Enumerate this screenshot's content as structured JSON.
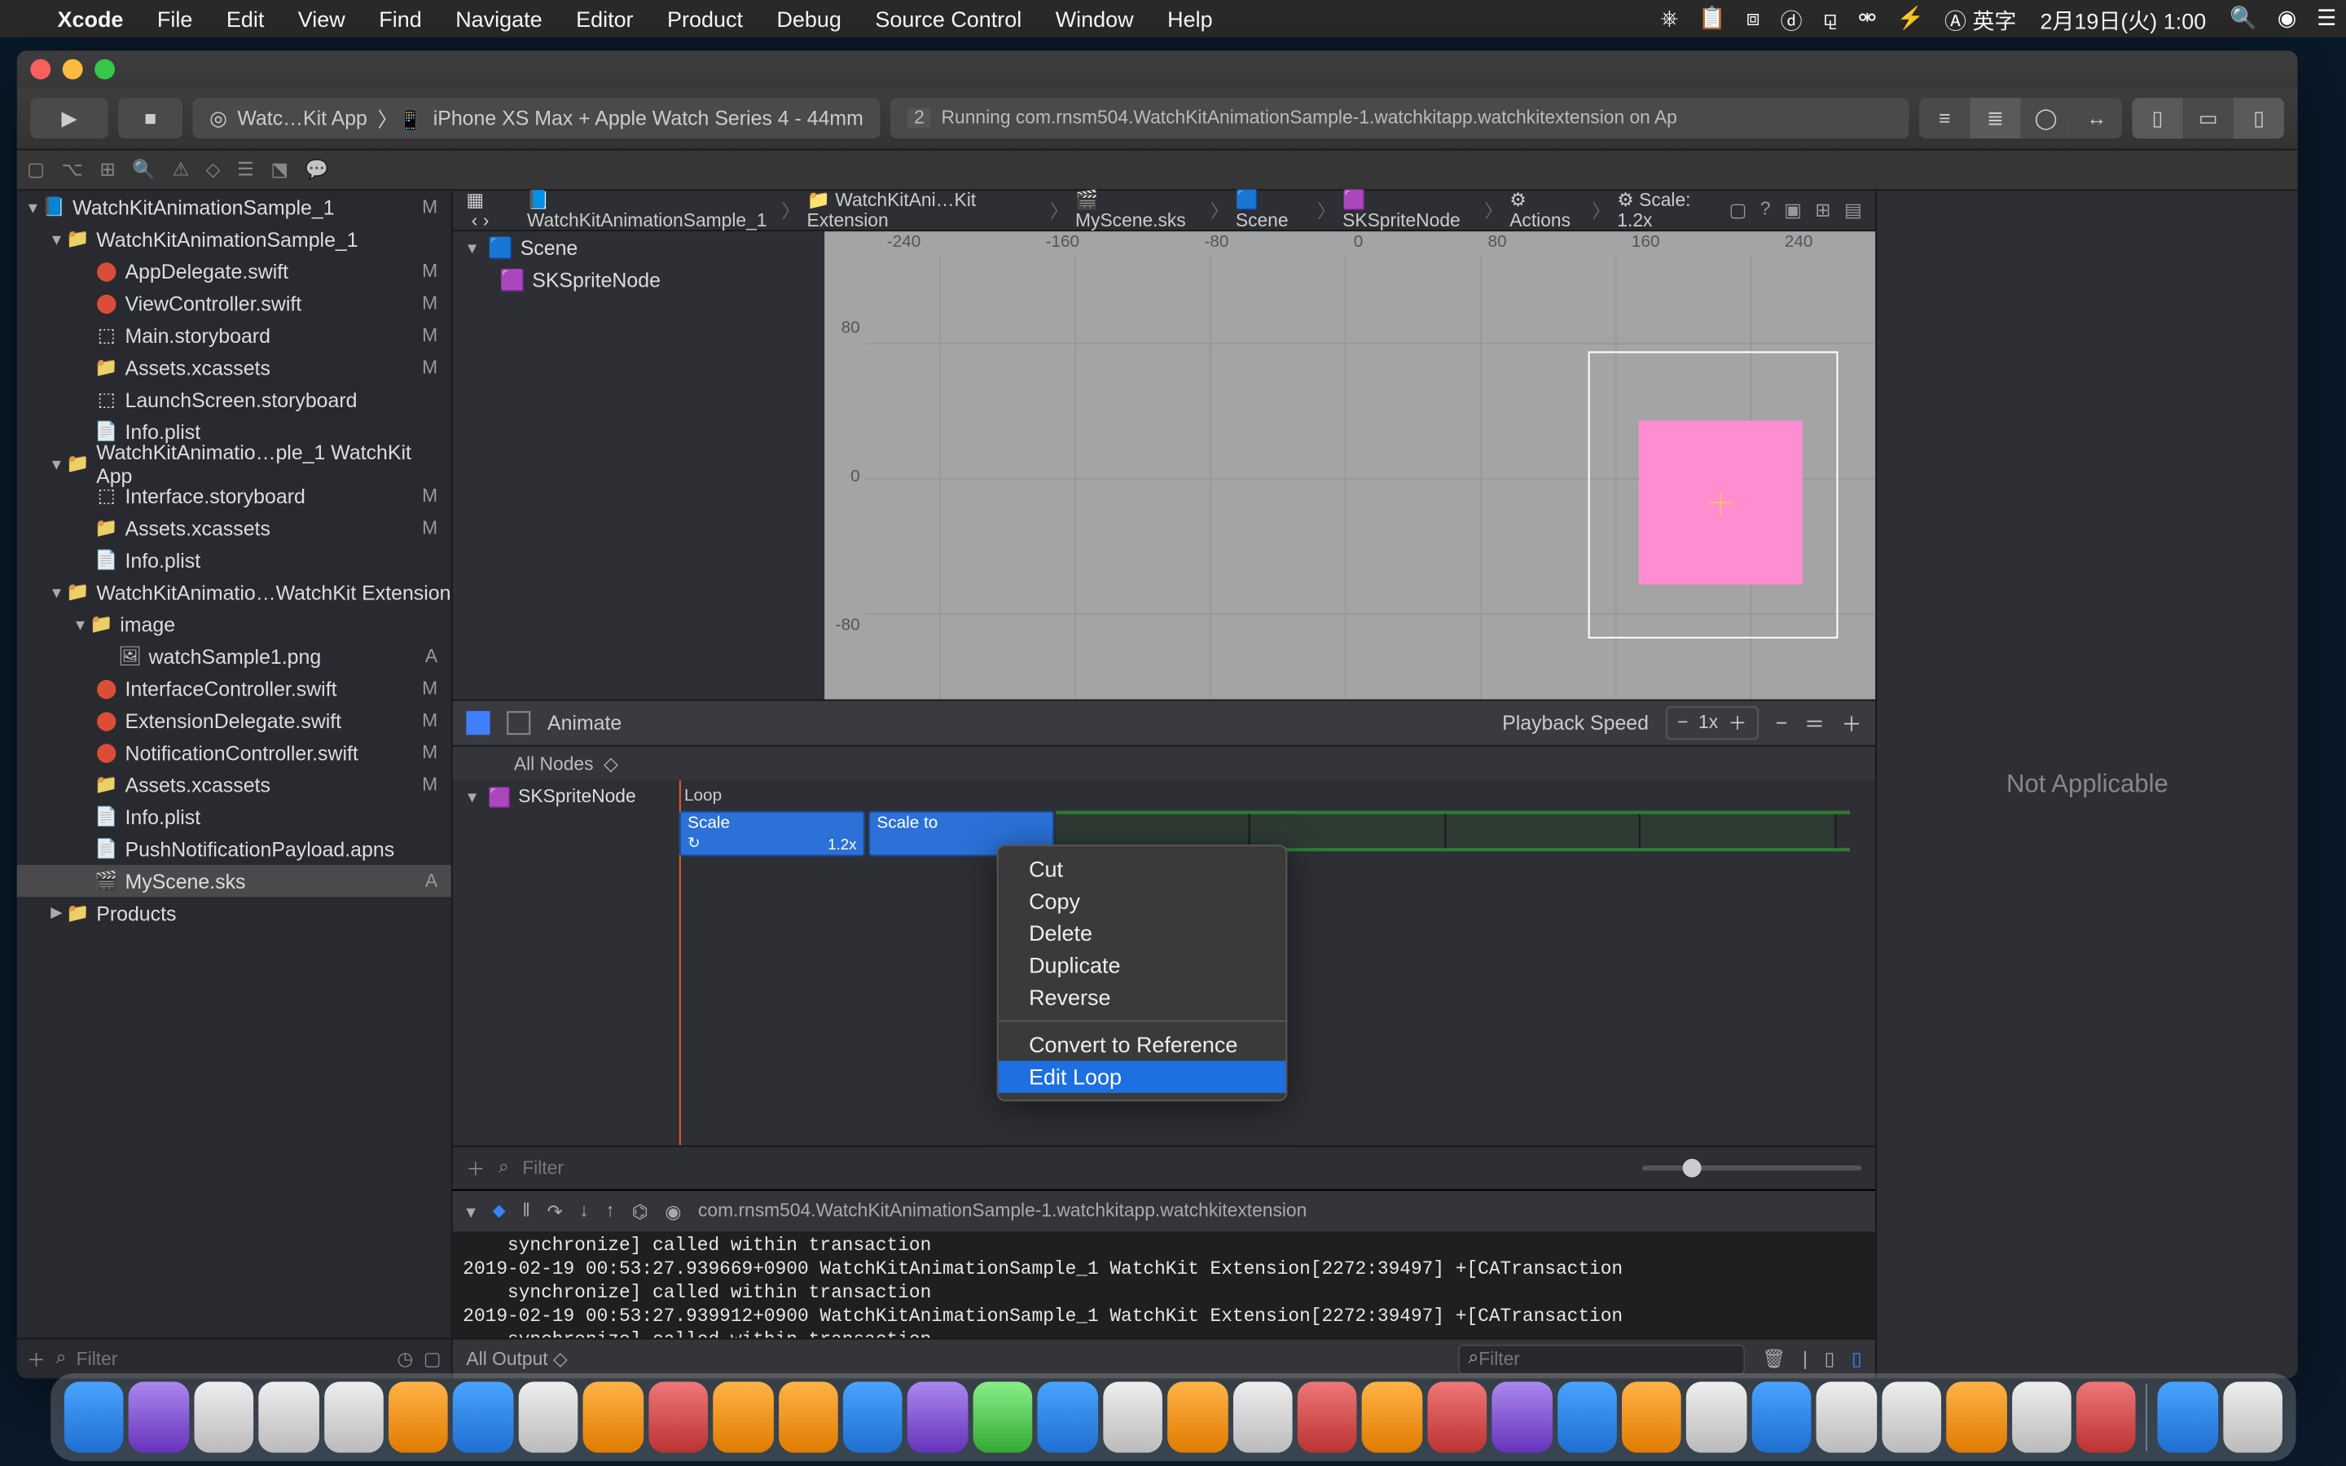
{
  "menubar": {
    "app": "Xcode",
    "items": [
      "File",
      "Edit",
      "View",
      "Find",
      "Navigate",
      "Editor",
      "Product",
      "Debug",
      "Source Control",
      "Window",
      "Help"
    ],
    "input_mode": "英字",
    "clock": "2月19日(火)  1:00"
  },
  "toolbar": {
    "scheme": "Watc…Kit App",
    "device": "iPhone XS Max + Apple Watch Series 4 - 44mm",
    "status_badge": "2",
    "status": "Running com.rnsm504.WatchKitAnimationSample-1.watchkitapp.watchkitextension on Ap"
  },
  "tree": {
    "root": "WatchKitAnimationSample_1",
    "root_mod": "M",
    "g1": "WatchKitAnimationSample_1",
    "f_appdel": "AppDelegate.swift",
    "f_vc": "ViewController.swift",
    "f_main": "Main.storyboard",
    "f_assets1": "Assets.xcassets",
    "f_launch": "LaunchScreen.storyboard",
    "f_info1": "Info.plist",
    "g2": "WatchKitAnimatio…ple_1 WatchKit App",
    "f_iface": "Interface.storyboard",
    "f_assets2": "Assets.xcassets",
    "f_info2": "Info.plist",
    "g3": "WatchKitAnimatio…WatchKit Extension",
    "g_image": "image",
    "f_png": "watchSample1.png",
    "f_ic": "InterfaceController.swift",
    "f_ed": "ExtensionDelegate.swift",
    "f_nc": "NotificationController.swift",
    "f_assets3": "Assets.xcassets",
    "f_info3": "Info.plist",
    "f_apns": "PushNotificationPayload.apns",
    "f_scene": "MyScene.sks",
    "g4": "Products"
  },
  "mods": {
    "appdel": "M",
    "vc": "M",
    "main": "M",
    "assets1": "M",
    "iface": "M",
    "assets2": "M",
    "png": "A",
    "ic": "M",
    "ed": "M",
    "nc": "M",
    "assets3": "M",
    "scene": "A"
  },
  "breadcrumb": {
    "b1": "WatchKitAnimationSample_1",
    "b2": "WatchKitAni…Kit Extension",
    "b3": "MyScene.sks",
    "b4": "Scene",
    "b5": "SKSpriteNode",
    "b6": "Actions",
    "b7": "Scale: 1.2x"
  },
  "outline": {
    "scene": "Scene",
    "node": "SKSpriteNode"
  },
  "canvas": {
    "x_ticks": [
      "-240",
      "-160",
      "-80",
      "0",
      "80",
      "160",
      "240"
    ],
    "y_ticks": [
      "80",
      "0",
      "-80"
    ]
  },
  "animbar": {
    "label": "Animate",
    "speed_label": "Playback Speed",
    "speed_value": "1x"
  },
  "timeline": {
    "nodes_label": "All Nodes",
    "row_node": "SKSpriteNode",
    "loop_label": "Loop",
    "a1_name": "Scale",
    "a1_val": "1.2x",
    "a2_name": "Scale to",
    "filter_ph": "Filter"
  },
  "ctx": {
    "cut": "Cut",
    "copy": "Copy",
    "del": "Delete",
    "dup": "Duplicate",
    "rev": "Reverse",
    "conv": "Convert to Reference",
    "loop": "Edit Loop"
  },
  "console": {
    "process": "com.rnsm504.WatchKitAnimationSample-1.watchkitapp.watchkitextension",
    "body": "    synchronize] called within transaction\n2019-02-19 00:53:27.939669+0900 WatchKitAnimationSample_1 WatchKit Extension[2272:39497] +[CATransaction\n    synchronize] called within transaction\n2019-02-19 00:53:27.939912+0900 WatchKitAnimationSample_1 WatchKit Extension[2272:39497] +[CATransaction\n    synchronize] called within transaction",
    "output_label": "All Output",
    "filter_ph": "Filter"
  },
  "inspector": {
    "msg": "Not Applicable"
  },
  "scene_filter_ph": "Filter",
  "sidebar_filter_ph": "Filter"
}
